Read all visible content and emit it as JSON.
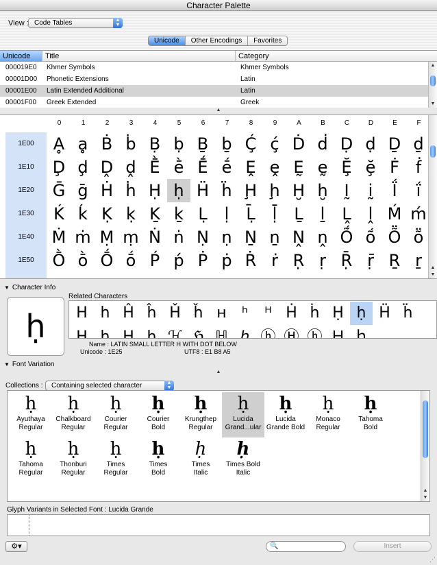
{
  "window": {
    "title": "Character Palette"
  },
  "toolbar": {
    "view_label": "View :",
    "view_value": "Code Tables"
  },
  "tabs": [
    {
      "label": "Unicode",
      "active": true
    },
    {
      "label": "Other Encodings",
      "active": false
    },
    {
      "label": "Favorites",
      "active": false
    }
  ],
  "block_table": {
    "columns": [
      "Unicode",
      "Title",
      "Category"
    ],
    "rows": [
      {
        "code": "000019E0",
        "title": "Khmer Symbols",
        "category": "Khmer Symbols",
        "selected": false
      },
      {
        "code": "00001D00",
        "title": "Phonetic Extensions",
        "category": "Latin",
        "selected": false
      },
      {
        "code": "00001E00",
        "title": "Latin Extended Additional",
        "category": "Latin",
        "selected": true
      },
      {
        "code": "00001F00",
        "title": "Greek Extended",
        "category": "Greek",
        "selected": false
      }
    ]
  },
  "char_grid": {
    "columns": [
      "0",
      "1",
      "2",
      "3",
      "4",
      "5",
      "6",
      "7",
      "8",
      "9",
      "A",
      "B",
      "C",
      "D",
      "E",
      "F"
    ],
    "rows": [
      {
        "label": "1E00",
        "chars": [
          "Ḁ",
          "ḁ",
          "Ḃ",
          "ḃ",
          "Ḅ",
          "ḅ",
          "Ḇ",
          "ḇ",
          "Ḉ",
          "ḉ",
          "Ḋ",
          "ḋ",
          "Ḍ",
          "ḍ",
          "Ḏ",
          "ḏ"
        ]
      },
      {
        "label": "1E10",
        "chars": [
          "Ḑ",
          "ḑ",
          "Ḓ",
          "ḓ",
          "Ḕ",
          "ḕ",
          "Ḗ",
          "ḗ",
          "Ḙ",
          "ḙ",
          "Ḛ",
          "ḛ",
          "Ḝ",
          "ḝ",
          "Ḟ",
          "ḟ"
        ]
      },
      {
        "label": "1E20",
        "chars": [
          "Ḡ",
          "ḡ",
          "Ḣ",
          "ḣ",
          "Ḥ",
          "ḥ",
          "Ḧ",
          "ḧ",
          "Ḩ",
          "ḩ",
          "Ḫ",
          "ḫ",
          "Ḭ",
          "ḭ",
          "Ḯ",
          "ḯ"
        ]
      },
      {
        "label": "1E30",
        "chars": [
          "Ḱ",
          "ḱ",
          "Ḳ",
          "ḳ",
          "Ḵ",
          "ḵ",
          "Ḷ",
          "ḷ",
          "Ḹ",
          "ḹ",
          "Ḻ",
          "ḻ",
          "Ḽ",
          "ḽ",
          "Ḿ",
          "ḿ"
        ]
      },
      {
        "label": "1E40",
        "chars": [
          "Ṁ",
          "ṁ",
          "Ṃ",
          "ṃ",
          "Ṅ",
          "ṅ",
          "Ṇ",
          "ṇ",
          "Ṉ",
          "ṉ",
          "Ṋ",
          "ṋ",
          "Ṍ",
          "ṍ",
          "Ṏ",
          "ṏ"
        ]
      },
      {
        "label": "1E50",
        "chars": [
          "Ṑ",
          "ṑ",
          "Ṓ",
          "ṓ",
          "Ṕ",
          "ṕ",
          "Ṗ",
          "ṗ",
          "Ṙ",
          "ṙ",
          "Ṛ",
          "ṛ",
          "Ṝ",
          "ṝ",
          "Ṟ",
          "ṟ"
        ]
      }
    ],
    "selected": {
      "row": 2,
      "col": 5
    }
  },
  "character_info": {
    "section_label": "Character Info",
    "glyph": "ḥ",
    "related_label": "Related Characters",
    "related_row1": [
      "H",
      "h",
      "Ĥ",
      "ĥ",
      "Ȟ",
      "ȟ",
      "ʜ",
      "ʰ",
      "ᴴ",
      "Ḣ",
      "ḣ",
      "Ḥ",
      "ḥ",
      "Ḧ",
      "ḧ"
    ],
    "related_row2": [
      "Ḩ",
      "ḩ",
      "Ḫ",
      "ḫ",
      "ℋ",
      "ℌ",
      "ℍ",
      "ℎ",
      "ⓗ",
      "Ⓗ",
      "ⓗ",
      "Ｈ",
      "ｈ"
    ],
    "related_selected": 12,
    "name_label": "Name :",
    "name_value": "LATIN SMALL LETTER H WITH DOT BELOW",
    "unicode_label": "Unicode :",
    "unicode_value": "1E25",
    "utf8_label": "UTF8 :",
    "utf8_value": "E1 B8 A5"
  },
  "font_variation": {
    "section_label": "Font Variation",
    "collections_label": "Collections :",
    "collections_value": "Containing selected character",
    "fonts": [
      {
        "glyph": "ḥ",
        "name": "Ayuthaya\nRegular"
      },
      {
        "glyph": "ḥ",
        "name": "Chalkboard\nRegular"
      },
      {
        "glyph": "ḥ",
        "name": "Courier\nRegular"
      },
      {
        "glyph": "ḥ",
        "name": "Courier\nBold"
      },
      {
        "glyph": "ḥ",
        "name": "Krungthep\nRegular"
      },
      {
        "glyph": "ḥ",
        "name": "Lucida\nGrand...ular",
        "selected": true
      },
      {
        "glyph": "ḥ",
        "name": "Lucida\nGrande Bold"
      },
      {
        "glyph": "ḥ",
        "name": "Monaco\nRegular"
      },
      {
        "glyph": "ḥ",
        "name": "Tahoma\nBold"
      },
      {
        "glyph": "ḥ",
        "name": "Tahoma\nRegular"
      },
      {
        "glyph": "ḥ",
        "name": "Thonburi\nRegular"
      },
      {
        "glyph": "ḥ",
        "name": "Times\nRegular"
      },
      {
        "glyph": "ḥ",
        "name": "Times\nBold"
      },
      {
        "glyph": "ḥ",
        "name": "Times\nItalic"
      },
      {
        "glyph": "ḥ",
        "name": "Times Bold\nItalic"
      }
    ],
    "variants_label": "Glyph Variants in Selected Font : Lucida Grande"
  },
  "bottom_bar": {
    "search_value": "",
    "search_placeholder": "",
    "insert_label": "Insert"
  }
}
